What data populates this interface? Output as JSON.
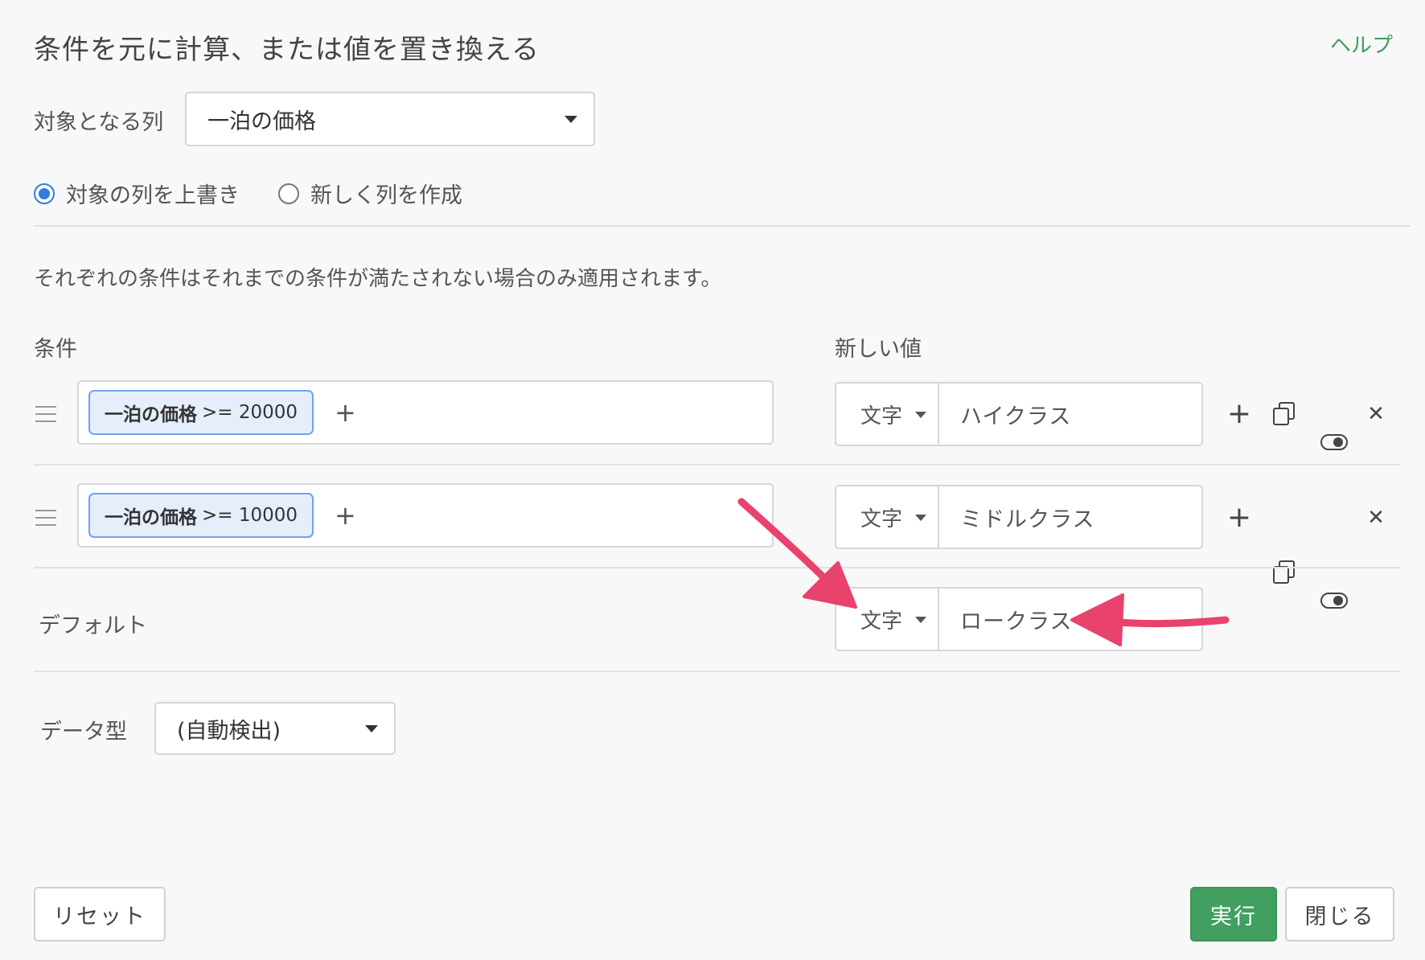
{
  "dialog": {
    "title": "条件を元に計算、または値を置き換える",
    "help_label": "ヘルプ"
  },
  "target": {
    "label": "対象となる列",
    "selected": "一泊の価格"
  },
  "mode": {
    "overwrite_label": "対象の列を上書き",
    "new_column_label": "新しく列を作成",
    "selected": "overwrite"
  },
  "note": "それぞれの条件はそれまでの条件が満たされない場合のみ適用されます。",
  "headers": {
    "condition": "条件",
    "new_value": "新しい値"
  },
  "rules": [
    {
      "column": "一泊の価格",
      "operator_value": ">= 20000",
      "type": "文字",
      "value": "ハイクラス"
    },
    {
      "column": "一泊の価格",
      "operator_value": ">= 10000",
      "type": "文字",
      "value": "ミドルクラス"
    }
  ],
  "default": {
    "label": "デフォルト",
    "type": "文字",
    "value": "ロークラス"
  },
  "data_type": {
    "label": "データ型",
    "selected": "(自動検出)"
  },
  "buttons": {
    "reset": "リセット",
    "run": "実行",
    "close": "閉じる"
  },
  "colors": {
    "accent_green": "#41a060",
    "radio_blue": "#2f7de1",
    "annotation_arrow": "#e8426d",
    "chip_border": "#6fa3ea"
  }
}
